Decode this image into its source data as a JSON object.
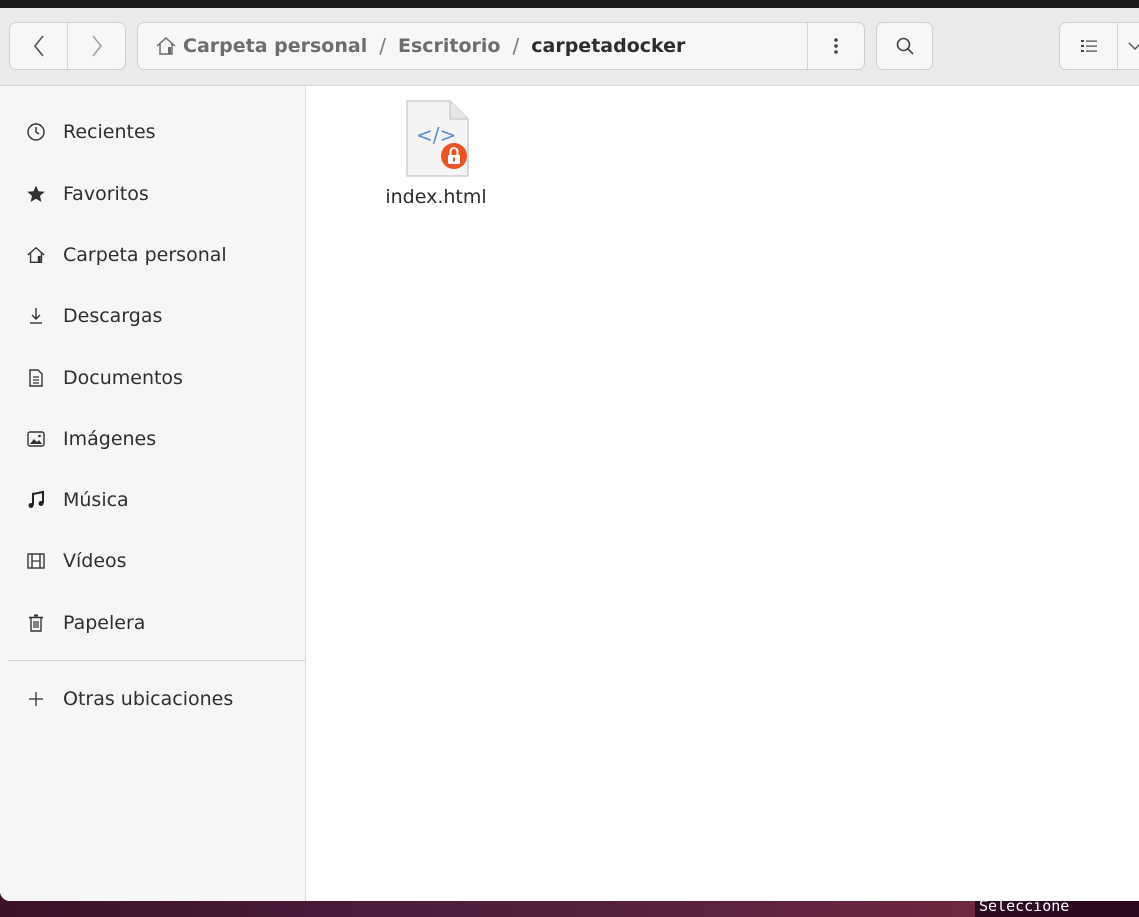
{
  "window": {
    "nav": {
      "back_icon": "chevron-left-icon",
      "forward_icon": "chevron-right-icon"
    },
    "pathbar": {
      "home_icon": "home-icon",
      "crumbs": [
        "Carpeta personal",
        "Escritorio",
        "carpetadocker"
      ],
      "separator": "/",
      "menu_icon": "vertical-dots-icon"
    },
    "search_icon": "search-icon",
    "view": {
      "list_icon": "list-view-icon",
      "dropdown_icon": "chevron-down-icon"
    }
  },
  "sidebar": {
    "items": [
      {
        "label": "Recientes",
        "icon": "clock-icon"
      },
      {
        "label": "Favoritos",
        "icon": "star-icon"
      },
      {
        "label": "Carpeta personal",
        "icon": "home-icon"
      },
      {
        "label": "Descargas",
        "icon": "download-icon"
      },
      {
        "label": "Documentos",
        "icon": "document-icon"
      },
      {
        "label": "Imágenes",
        "icon": "image-icon"
      },
      {
        "label": "Música",
        "icon": "music-icon"
      },
      {
        "label": "Vídeos",
        "icon": "film-icon"
      },
      {
        "label": "Papelera",
        "icon": "trash-icon"
      }
    ],
    "other_locations": {
      "label": "Otras ubicaciones",
      "icon": "plus-icon"
    }
  },
  "content": {
    "files": [
      {
        "name": "index.html",
        "icon": "html-file-icon",
        "badge": "lock-icon"
      }
    ]
  },
  "terminal_peek": {
    "line1": ": : :",
    "line2": "Seleccione"
  },
  "colors": {
    "accent": "#e95420",
    "desktop": "#4a1b3b",
    "file_icon_code": "#5b8dd9"
  }
}
